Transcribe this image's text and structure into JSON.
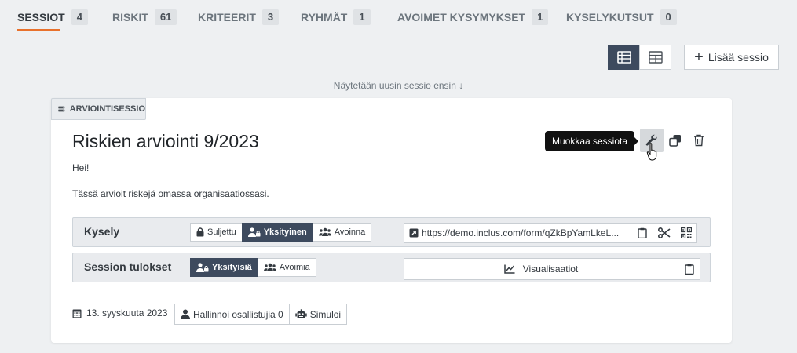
{
  "tabs": [
    {
      "label": "SESSIOT",
      "count": "4"
    },
    {
      "label": "RISKIT",
      "count": "61"
    },
    {
      "label": "KRITEERIT",
      "count": "3"
    },
    {
      "label": "RYHMÄT",
      "count": "1"
    },
    {
      "label": "AVOIMET KYSYMYKSET",
      "count": "1"
    },
    {
      "label": "KYSELYKUTSUT",
      "count": "0"
    }
  ],
  "toolbar": {
    "add_session": "Lisää sessio"
  },
  "order_note": "Näytetään uusin sessio ensin ↓",
  "session": {
    "type_tag": "ARVIOINTISESSIO",
    "title": "Riskien arviointi 9/2023",
    "description_line1": "Hei!",
    "description_line2": "Tässä arvioit riskejä omassa organisaatiossasi.",
    "tooltip": "Muokkaa sessiota",
    "survey": {
      "label": "Kysely",
      "options": [
        "Suljettu",
        "Yksityinen",
        "Avoinna"
      ],
      "selected": "Yksityinen",
      "url": "https://demo.inclus.com/form/qZkBpYamLkeL..."
    },
    "results": {
      "label": "Session tulokset",
      "options": [
        "Yksityisiä",
        "Avoimia"
      ],
      "selected": "Yksityisiä",
      "visualizations": "Visualisaatiot"
    },
    "date": "13. syyskuuta 2023",
    "manage_participants": "Hallinnoi osallistujia 0",
    "simulate": "Simuloi"
  },
  "colors": {
    "accent": "#e8712c",
    "dark": "#3d4a5e"
  }
}
